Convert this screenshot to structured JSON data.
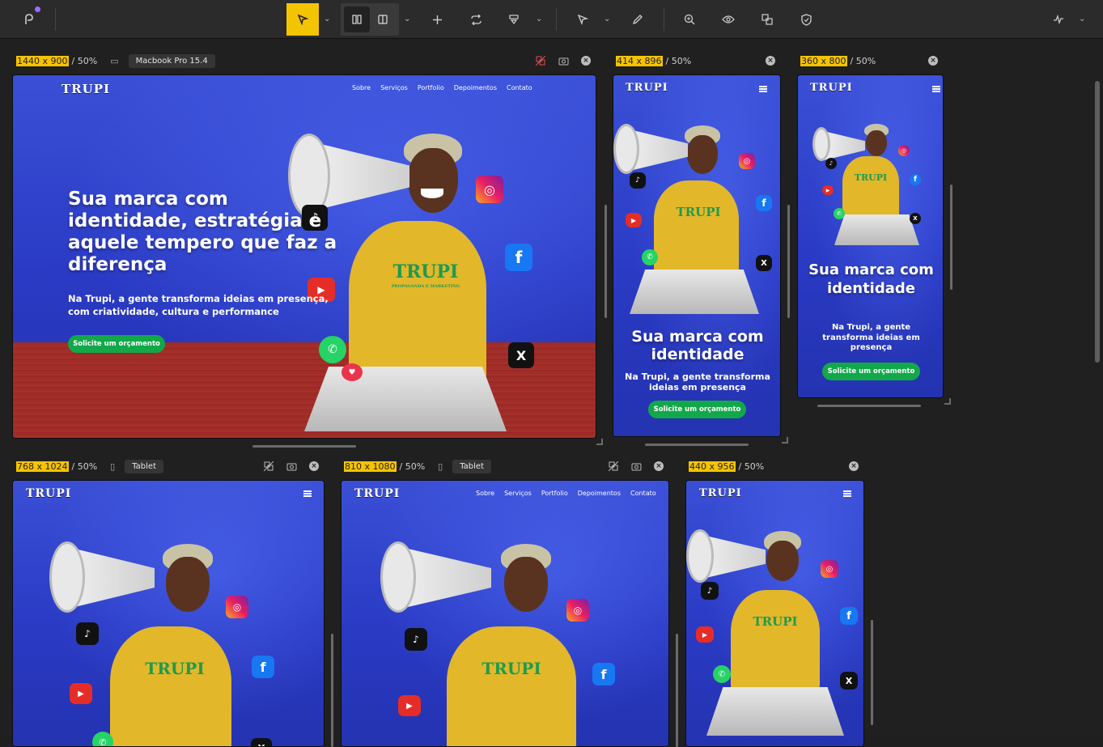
{
  "toolbar": {
    "icons": [
      "app-logo-icon",
      "select-cursor-icon",
      "layout-columns-icon",
      "layout-split-icon",
      "add-icon",
      "rotate-icon",
      "inspect-icon",
      "pointer-icon",
      "edit-icon",
      "zoom-in-icon",
      "eye-icon",
      "sync-icon",
      "shield-icon",
      "activity-icon"
    ],
    "accent": "#f5c400"
  },
  "frames": [
    {
      "size": "1440 x 900",
      "zoom": "/ 50%",
      "device": "Macbook Pro 15.4"
    },
    {
      "size": "414 x 896",
      "zoom": "/ 50%"
    },
    {
      "size": "360 x 800",
      "zoom": "/ 50%"
    },
    {
      "size": "768 x 1024",
      "zoom": "/ 50%",
      "device": "Tablet"
    },
    {
      "size": "810 x 1080",
      "zoom": "/ 50%",
      "device": "Tablet"
    },
    {
      "size": "440 x 956",
      "zoom": "/ 50%"
    }
  ],
  "site": {
    "brand": "TRUPI",
    "shirt_tagline": "PROPAGANDA E MARKETING",
    "nav": [
      "Sobre",
      "Serviços",
      "Portfolio",
      "Depoimentos",
      "Contato"
    ],
    "hero_title_desktop": "Sua marca com identidade, estratégia e aquele tempero que faz a diferença",
    "hero_sub_desktop": "Na Trupi, a gente transforma ideias em presença, com criatividade, cultura e performance",
    "hero_title_mobile": "Sua marca com identidade",
    "hero_sub_mobile": "Na Trupi, a gente transforma ideias em presença",
    "cta": "Solicite um orçamento"
  }
}
